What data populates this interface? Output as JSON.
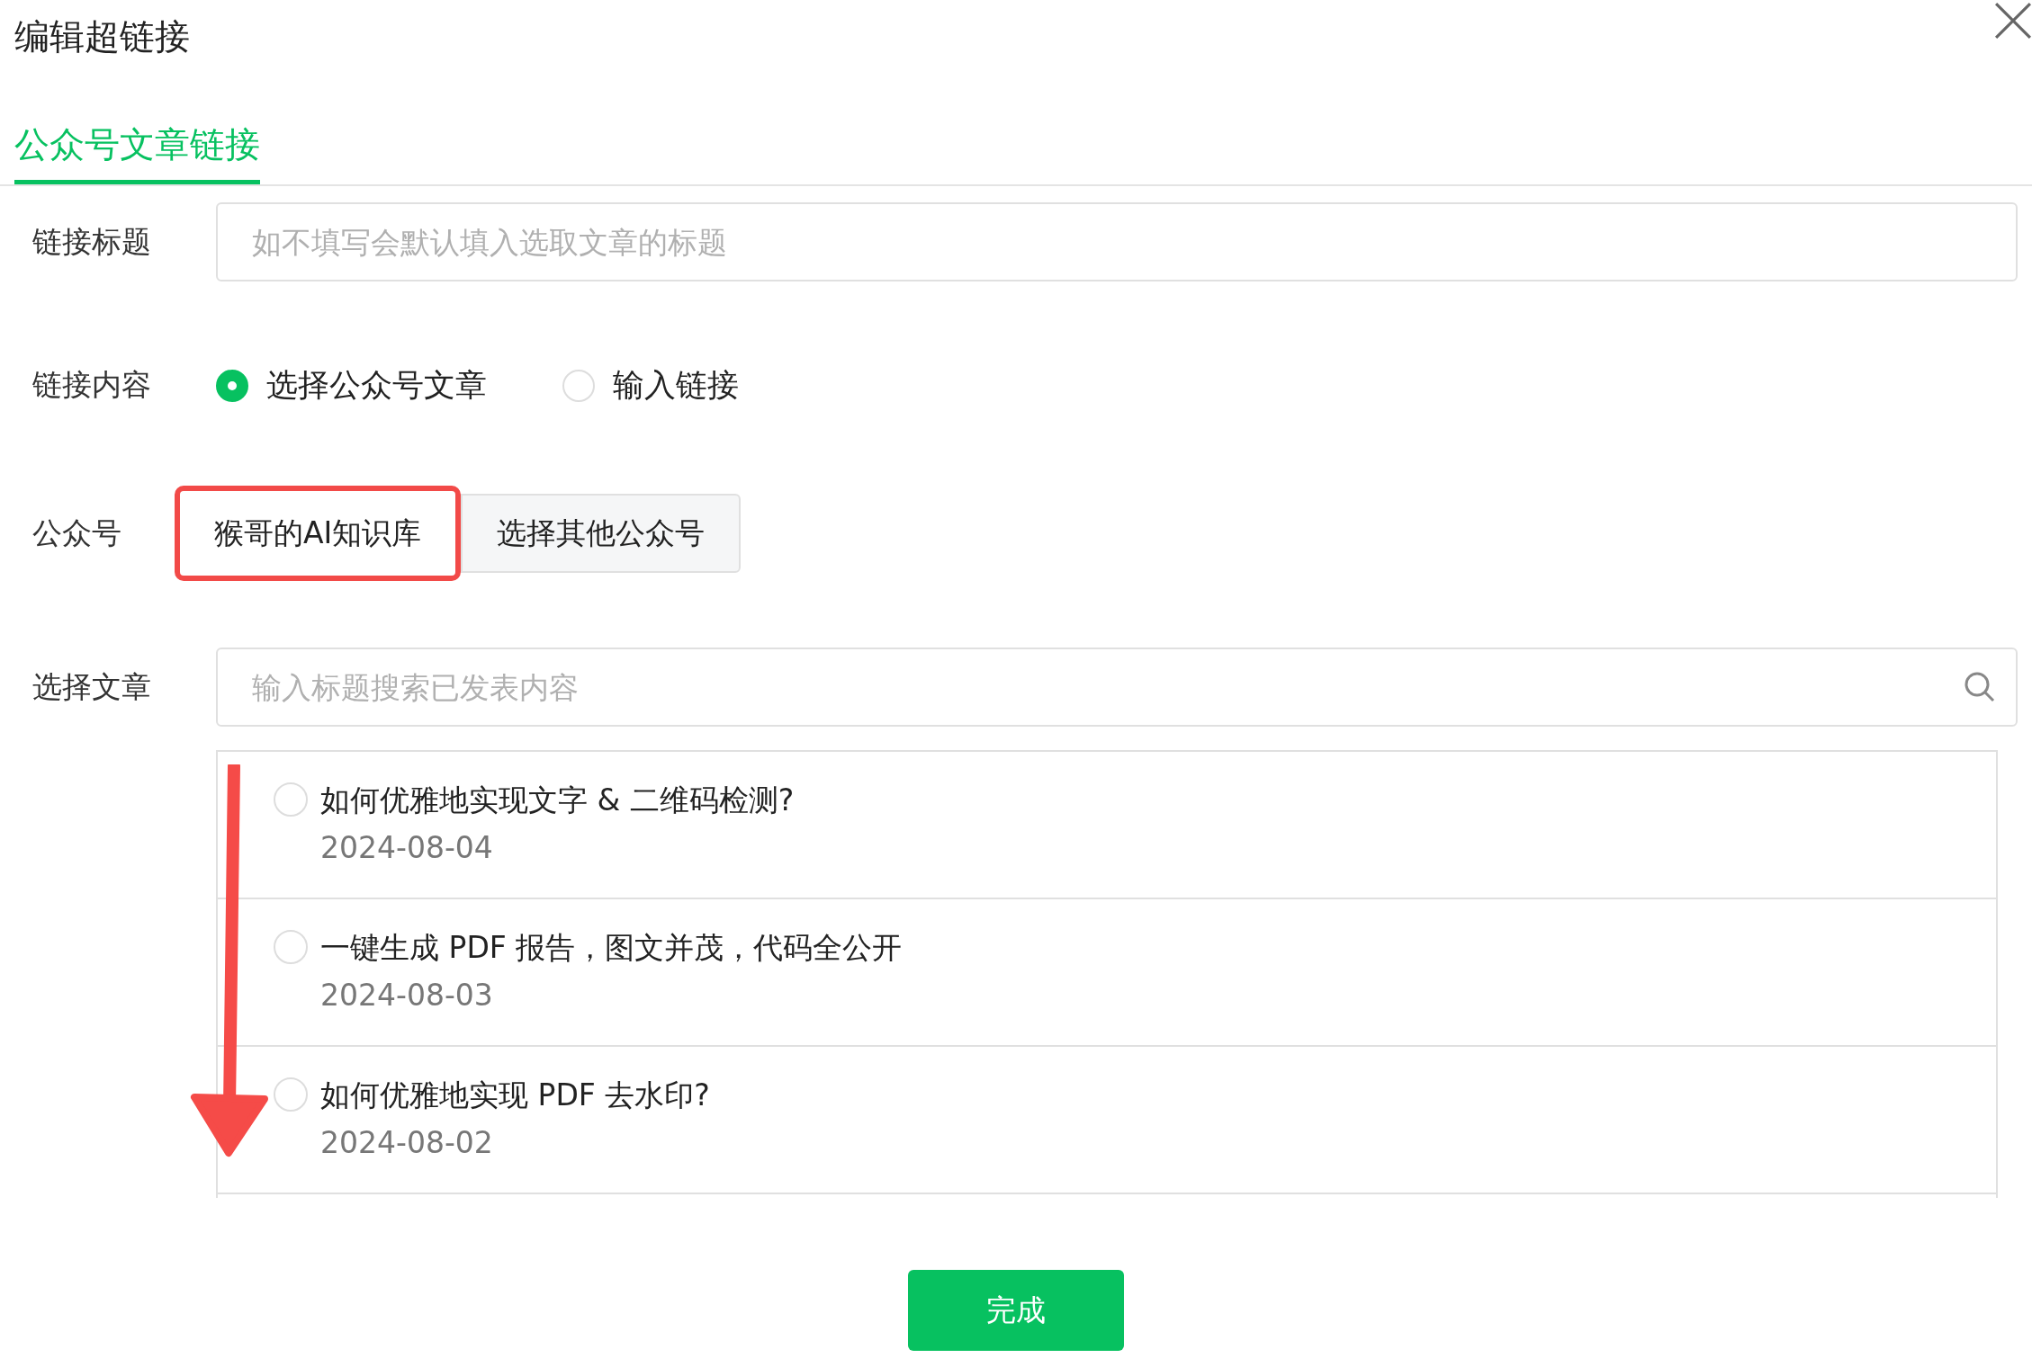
{
  "dialog": {
    "title": "编辑超链接"
  },
  "tabs": [
    {
      "label": "公众号文章链接",
      "selected": true
    }
  ],
  "link_title": {
    "label": "链接标题",
    "placeholder": "如不填写会默认填入选取文章的标题"
  },
  "link_content": {
    "label": "链接内容",
    "options": [
      {
        "label": "选择公众号文章",
        "selected": true
      },
      {
        "label": "输入链接",
        "selected": false
      }
    ]
  },
  "account": {
    "label": "公众号",
    "buttons": [
      {
        "label": "猴哥的AI知识库",
        "selected": true
      },
      {
        "label": "选择其他公众号",
        "selected": false
      }
    ]
  },
  "article": {
    "label": "选择文章",
    "placeholder": "输入标题搜索已发表内容",
    "items": [
      {
        "title": "如何优雅地实现文字 & 二维码检测?",
        "date": "2024-08-04",
        "selected": false
      },
      {
        "title": "一键生成 PDF 报告，图文并茂，代码全公开",
        "date": "2024-08-03",
        "selected": false
      },
      {
        "title": "如何优雅地实现 PDF 去水印?",
        "date": "2024-08-02",
        "selected": false
      }
    ]
  },
  "done_button": "完成"
}
